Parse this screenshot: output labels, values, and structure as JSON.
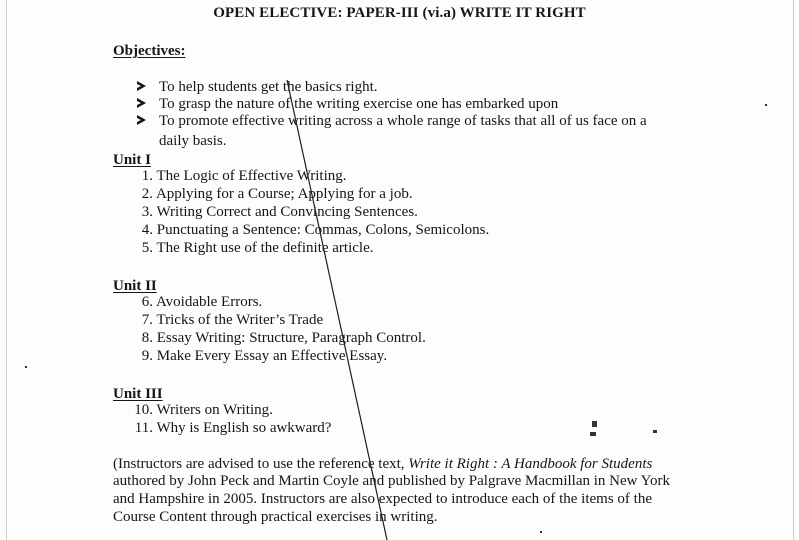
{
  "title": "OPEN ELECTIVE: PAPER-III (vi.a) WRITE IT RIGHT",
  "objectives": {
    "heading": "Objectives:",
    "items": [
      "To help students get the basics right.",
      "To grasp the nature of the writing exercise one has embarked upon",
      "To promote effective writing across a whole range of tasks that all of us face on a",
      "daily basis."
    ]
  },
  "unit1": {
    "heading": "Unit I",
    "items": [
      {
        "num": "1.",
        "text": "The Logic of Effective Writing."
      },
      {
        "num": "2.",
        "text": "Applying for a Course; Applying for a job."
      },
      {
        "num": "3.",
        "text": "Writing Correct and Convincing Sentences."
      },
      {
        "num": "4.",
        "text": "Punctuating a Sentence: Commas, Colons, Semicolons."
      },
      {
        "num": "5.",
        "text": "The Right use of the definite article."
      }
    ]
  },
  "unit2": {
    "heading": "Unit II",
    "items": [
      {
        "num": "6.",
        "text": "Avoidable Errors."
      },
      {
        "num": "7.",
        "text": "Tricks of the Writer’s Trade"
      },
      {
        "num": "8.",
        "text": "Essay Writing: Structure, Paragraph Control."
      },
      {
        "num": "9.",
        "text": "Make Every Essay an Effective Essay."
      }
    ]
  },
  "unit3": {
    "heading": "Unit III",
    "items": [
      {
        "num": "10.",
        "text": "Writers on Writing."
      },
      {
        "num": "11.",
        "text": "Why is English so awkward?"
      }
    ]
  },
  "note": {
    "line1_a": "(Instructors are advised to use the reference text, ",
    "line1_b": "Write it Right : A Handbook for Students",
    "line2": "authored by John Peck and Martin Coyle and published by Palgrave Macmillan in New York",
    "line3": "and Hampshire in 2005. Instructors are also expected to introduce each of the items of the",
    "line4": "Course Content through practical exercises in writing."
  }
}
